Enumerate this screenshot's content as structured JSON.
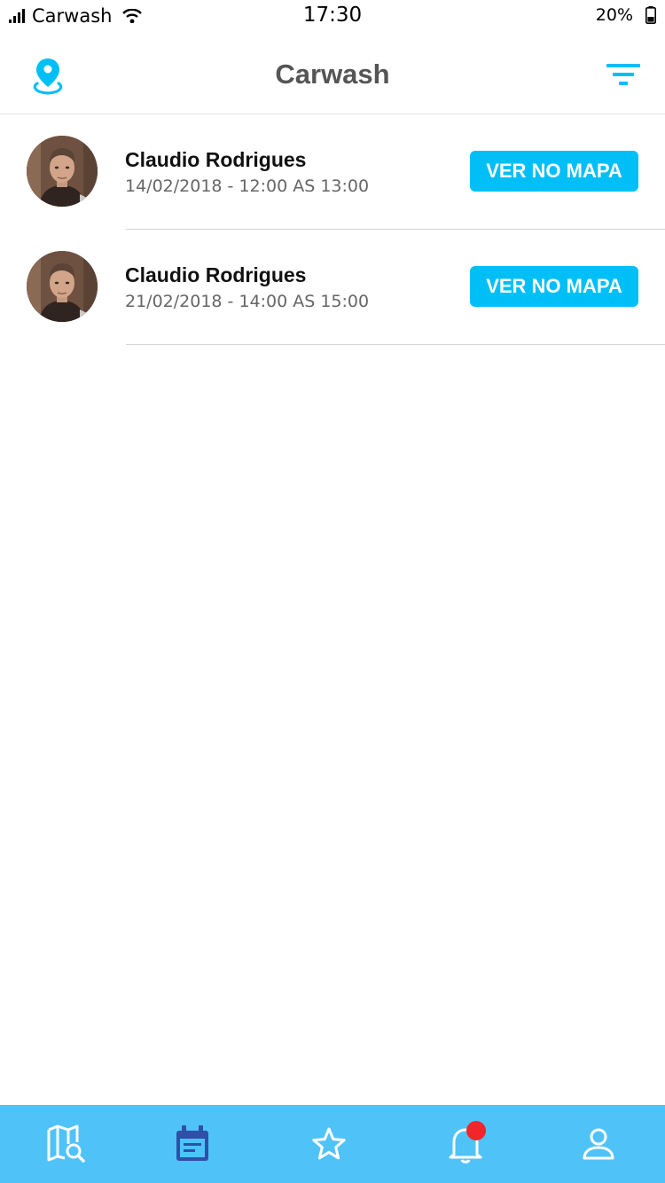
{
  "status_bar": {
    "carrier": "Carwash",
    "time": "17:30",
    "battery": "20%"
  },
  "nav": {
    "title": "Carwash",
    "left_icon": "location-pin-icon",
    "right_icon": "filter-icon"
  },
  "appointments": [
    {
      "name": "Claudio Rodrigues",
      "datetime": "14/02/2018 - 12:00 AS 13:00",
      "button_label": "VER NO MAPA"
    },
    {
      "name": "Claudio Rodrigues",
      "datetime": "21/02/2018 - 14:00 AS 15:00",
      "button_label": "VER NO MAPA"
    }
  ],
  "tab_bar": {
    "items": [
      "map-search-icon",
      "calendar-icon",
      "star-icon",
      "bell-icon",
      "profile-icon"
    ],
    "active_index": 1
  },
  "colors": {
    "accent": "#00bff7",
    "tab_bar": "#4fc3f7",
    "active_tab_icon": "#2f4fa8",
    "badge": "#f0262a",
    "title": "#555555"
  }
}
